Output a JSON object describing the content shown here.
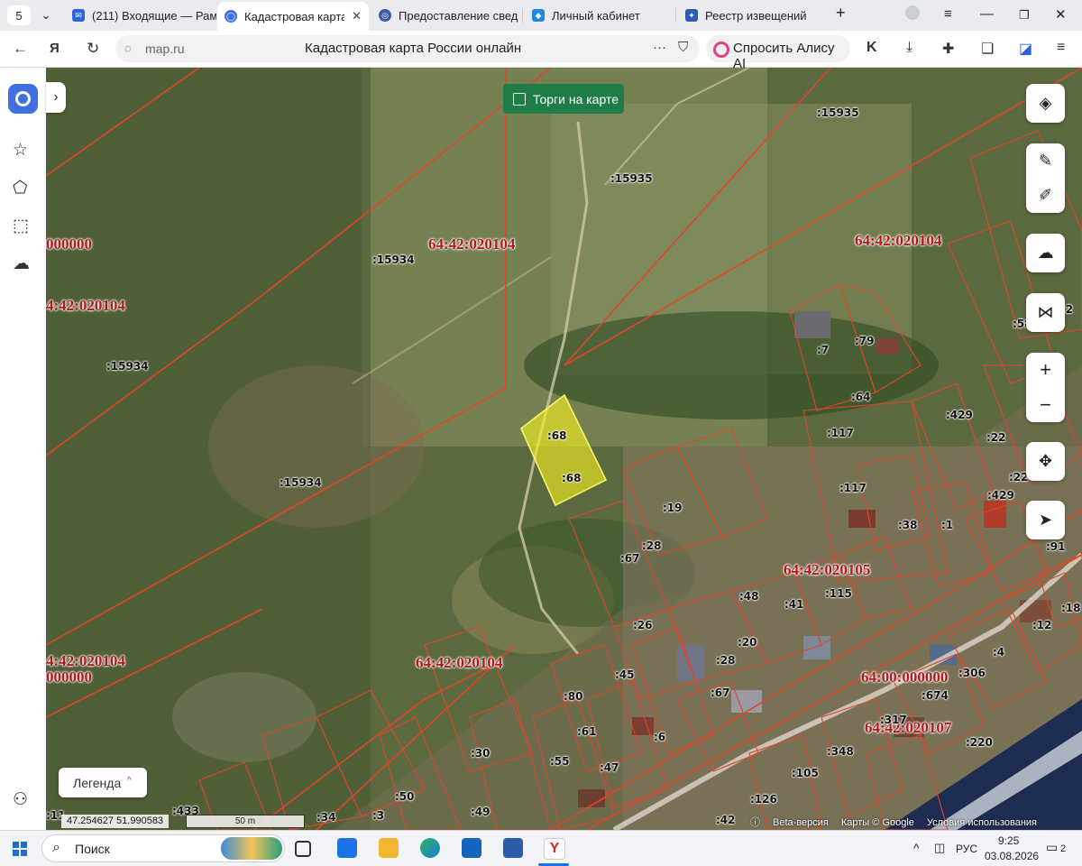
{
  "browser": {
    "tab_count": "5",
    "tabs": [
      {
        "label": "(211) Входящие — Рам",
        "favicon_color": "#2e62d9"
      },
      {
        "label": "Кадастровая карта",
        "favicon_color": "#3f6fe0",
        "active": true
      },
      {
        "label": "Предоставление свед",
        "favicon_color": "#3a5aa8"
      },
      {
        "label": "Личный кабинет",
        "favicon_color": "#1e88e5"
      },
      {
        "label": "Реестр извещений",
        "favicon_color": "#2d5cae"
      }
    ],
    "new_tab": "+",
    "address": {
      "domain": "map.ru",
      "page_title": "Кадастровая карта России онлайн",
      "more": "···"
    },
    "alice_button": "Спросить Алису AI"
  },
  "map": {
    "auction_toggle_label": "Торги на карте",
    "legend_label": "Легенда",
    "coordinates": "47.254627   51.990583",
    "scale_label": "50 m",
    "attribution": {
      "beta": "Beta-версия",
      "maps": "Карты © Google",
      "terms": "Условия использования"
    },
    "quarter_labels": [
      {
        "text": "64:42:020104"
      },
      {
        "text": "64:42:020104"
      },
      {
        "text": "64:42:020104"
      },
      {
        "text": "64:42:020104"
      },
      {
        "text": "000000"
      },
      {
        "text": "4:42:020104"
      },
      {
        "text": "4:42:020104"
      },
      {
        "text": "000000"
      },
      {
        "text": "64:42:020105"
      },
      {
        "text": "64:00:000000"
      },
      {
        "text": "64:42:020107"
      }
    ],
    "parcel_labels": [
      ":15935",
      ":15935",
      ":15934",
      ":15934",
      ":15934",
      ":68",
      ":68",
      ":7",
      ":79",
      ":64",
      ":117",
      ":117",
      ":429",
      ":429",
      ":22",
      ":22",
      ":58",
      ":2",
      ":19",
      ":28",
      ":67",
      ":38",
      ":1",
      ":91",
      ":48",
      ":41",
      ":115",
      ":20",
      ":26",
      ":28",
      ":45",
      ":67",
      ":80",
      ":61",
      ":6",
      ":55",
      ":47",
      ":30",
      ":50",
      ":49",
      ":3",
      ":34",
      ":433",
      ":11",
      ":306",
      ":674",
      ":317",
      ":220",
      ":348",
      ":105",
      ":126",
      ":42",
      ":4",
      ":12",
      ":18",
      ":8"
    ],
    "highlight_color": "#f4f21f",
    "boundary_color": "#e0452a"
  },
  "taskbar": {
    "search_label": "Поиск",
    "language": "РУС",
    "time": "9:25",
    "date": "03.08.2026",
    "notifications": "2"
  }
}
